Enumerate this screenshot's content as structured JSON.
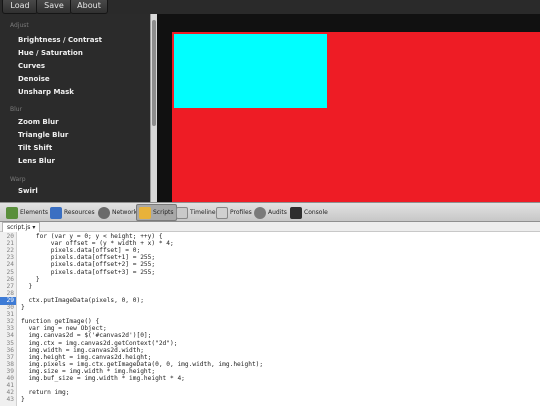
{
  "toolbar": {
    "load_label": "Load",
    "save_label": "Save",
    "about_label": "About"
  },
  "sidebar": {
    "sections": [
      {
        "label": "Adjust",
        "items": [
          "Brightness / Contrast",
          "Hue / Saturation",
          "Curves",
          "Denoise",
          "Unsharp Mask"
        ]
      },
      {
        "label": "Blur",
        "items": [
          "Zoom Blur",
          "Triangle Blur",
          "Tilt Shift",
          "Lens Blur"
        ]
      },
      {
        "label": "Warp",
        "items": [
          "Swirl"
        ]
      }
    ]
  },
  "colors": {
    "canvas_red": "#ee1c25",
    "canvas_cyan": "#00ffff",
    "breakpoint": "#3d7bd6"
  },
  "devtools": {
    "tabs": [
      {
        "label": "Elements",
        "icon": "elements-icon"
      },
      {
        "label": "Resources",
        "icon": "resources-icon"
      },
      {
        "label": "Network",
        "icon": "network-icon"
      },
      {
        "label": "Scripts",
        "icon": "scripts-icon",
        "active": true
      },
      {
        "label": "Timeline",
        "icon": "timeline-icon"
      },
      {
        "label": "Profiles",
        "icon": "profiles-icon"
      },
      {
        "label": "Audits",
        "icon": "audits-icon"
      },
      {
        "label": "Console",
        "icon": "console-icon"
      }
    ],
    "file_tab": "script.js ▾",
    "breakpoint_line": "29",
    "code_lines": [
      {
        "n": "20",
        "text": "    for (var y = 0; y < height; ++y) {"
      },
      {
        "n": "21",
        "text": "        var offset = (y * width + x) * 4;"
      },
      {
        "n": "22",
        "text": "        pixels.data[offset] = 0;"
      },
      {
        "n": "23",
        "text": "        pixels.data[offset+1] = 255;"
      },
      {
        "n": "24",
        "text": "        pixels.data[offset+2] = 255;"
      },
      {
        "n": "25",
        "text": "        pixels.data[offset+3] = 255;"
      },
      {
        "n": "26",
        "text": "    }"
      },
      {
        "n": "27",
        "text": "  }"
      },
      {
        "n": "28",
        "text": ""
      },
      {
        "n": "29",
        "text": "  ctx.putImageData(pixels, 0, 0);"
      },
      {
        "n": "30",
        "text": "}"
      },
      {
        "n": "31",
        "text": ""
      },
      {
        "n": "32",
        "text": "function getImage() {"
      },
      {
        "n": "33",
        "text": "  var img = new Object;"
      },
      {
        "n": "34",
        "text": "  img.canvas2d = $('#canvas2d')[0];"
      },
      {
        "n": "35",
        "text": "  img.ctx = img.canvas2d.getContext(\"2d\");"
      },
      {
        "n": "36",
        "text": "  img.width = img.canvas2d.width;"
      },
      {
        "n": "37",
        "text": "  img.height = img.canvas2d.height;"
      },
      {
        "n": "38",
        "text": "  img.pixels = img.ctx.getImageData(0, 0, img.width, img.height);"
      },
      {
        "n": "39",
        "text": "  img.size = img.width * img.height;"
      },
      {
        "n": "40",
        "text": "  img.buf_size = img.width * img.height * 4;"
      },
      {
        "n": "41",
        "text": ""
      },
      {
        "n": "42",
        "text": "  return img;"
      },
      {
        "n": "43",
        "text": "}"
      }
    ]
  }
}
